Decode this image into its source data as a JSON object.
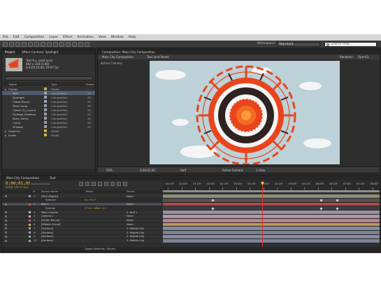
{
  "menu": [
    "File",
    "Edit",
    "Composition",
    "Layer",
    "Effect",
    "Animation",
    "View",
    "Window",
    "Help"
  ],
  "toolbar": {
    "workspace_label": "Workspace:",
    "workspace_value": "Standard",
    "search_placeholder": "Search Help"
  },
  "project": {
    "tabs": [
      "Project",
      "Effect Controls: Spotlight"
    ],
    "info": [
      "Text 6 ▾, used once",
      "862 x 318 (1.00)",
      "Δ 0;00;10;00, 29.97 fps"
    ],
    "columns": [
      "Name",
      "Type",
      "Frame"
    ],
    "rows": [
      {
        "name": "Comps",
        "type": "Folder",
        "frame": "",
        "color": "#c9b23a",
        "indent": 0
      },
      {
        "name": "Text",
        "type": "Composition",
        "frame": "29",
        "color": "#9aa0ad",
        "indent": 1
      },
      {
        "name": "Spotlight",
        "type": "Composition",
        "frame": "29",
        "color": "#9aa0ad",
        "indent": 1
      },
      {
        "name": "Chase Racuz",
        "type": "Composition",
        "frame": "29",
        "color": "#9aa0ad",
        "indent": 1
      },
      {
        "name": "Main Comp",
        "type": "Composition",
        "frame": "29",
        "color": "#9aa0ad",
        "indent": 1
      },
      {
        "name": "Chase (1)_Layout",
        "type": "Composition",
        "frame": "29",
        "color": "#9aa0ad",
        "indent": 1
      },
      {
        "name": "Footage_Skeleton",
        "type": "Composition",
        "frame": "29",
        "color": "#9aa0ad",
        "indent": 1
      },
      {
        "name": "Bone_Racks",
        "type": "Composition",
        "frame": "29",
        "color": "#9aa0ad",
        "indent": 1
      },
      {
        "name": "Comp",
        "type": "Composition",
        "frame": "29",
        "color": "#9aa0ad",
        "indent": 1
      },
      {
        "name": "Shadow",
        "type": "Composition",
        "frame": "29",
        "color": "#9aa0ad",
        "indent": 1
      },
      {
        "name": "Graphics",
        "type": "Folder",
        "frame": "",
        "color": "#c9b23a",
        "indent": 0
      },
      {
        "name": "Solids",
        "type": "Folder",
        "frame": "",
        "color": "#c9b23a",
        "indent": 0
      }
    ]
  },
  "comp": {
    "tab_title": "Composition: Main City Composition",
    "sub_tabs": [
      "Main City Composition",
      "Text (and Panel)"
    ],
    "active_camera": "Active Camera",
    "renderer_label": "Renderer:",
    "renderer_value": "OpenGL",
    "footer": {
      "zoom": "50%",
      "timecode": "0;00;01;00",
      "resolution": "Half",
      "view": "Active Camera",
      "views": "1 View"
    },
    "colors": {
      "sky": "#bcd1d8",
      "orange": "#e9451d",
      "sun": "#f36a24",
      "snow": "#f4f5f4"
    }
  },
  "timeline": {
    "tabs": [
      "Main City Composition",
      "Text"
    ],
    "timecode": "0;00;01;00",
    "frameinfo": "00030 (29.97 fps)",
    "columns": [
      "#",
      "Source Name",
      "Mode",
      "Parent"
    ],
    "layers": [
      {
        "num": "1",
        "name": "[Text (Right)]",
        "prop": "",
        "parent": "None",
        "color": "#9aa0ad",
        "type": "layer",
        "sel": false
      },
      {
        "num": "",
        "name": "Rotation",
        "prop": "0x +0.0°",
        "parent": "",
        "color": "",
        "type": "sub",
        "sel": false
      },
      {
        "num": "2",
        "name": "Null 1",
        "prop": "",
        "parent": "None",
        "color": "#e44",
        "type": "layer",
        "sel": true
      },
      {
        "num": "",
        "name": "Position",
        "prop": "274.0, 186.0, 0.0",
        "parent": "",
        "color": "",
        "type": "sub",
        "sel": false
      },
      {
        "num": "3",
        "name": "Main Camera",
        "prop": "",
        "parent": "2. Null 1",
        "color": "#c5b2c7",
        "type": "layer",
        "sel": false
      },
      {
        "num": "4",
        "name": "Camera 1",
        "prop": "",
        "parent": "None",
        "color": "#c5b2c7",
        "type": "layer",
        "sel": false
      },
      {
        "num": "5",
        "name": "[Green Racuz]",
        "prop": "",
        "parent": "None",
        "color": "#d45a5a",
        "type": "layer",
        "sel": false
      },
      {
        "num": "6",
        "name": "[Middle City.ai]",
        "prop": "",
        "parent": "None",
        "color": "#d9b33d",
        "type": "layer",
        "sel": false
      },
      {
        "num": "7",
        "name": "[Surface]",
        "prop": "",
        "parent": "2. Middle City",
        "color": "#9aa0ad",
        "type": "layer",
        "sel": false
      },
      {
        "num": "8",
        "name": "[Surface]",
        "prop": "",
        "parent": "2. Middle City",
        "color": "#9aa0ad",
        "type": "layer",
        "sel": false
      },
      {
        "num": "9",
        "name": "[Surface]",
        "prop": "",
        "parent": "2. Middle City",
        "color": "#9aa0ad",
        "type": "layer",
        "sel": false
      },
      {
        "num": "10",
        "name": "[Surface]",
        "prop": "",
        "parent": "2. Middle City",
        "color": "#9aa0ad",
        "type": "layer",
        "sel": false
      }
    ],
    "ruler_marks": [
      "00:15f",
      "01:00f",
      "01:15f",
      "02:00f",
      "02:15f",
      "03:00f",
      "03:15f",
      "04:00f",
      "04:15f",
      "05:00f",
      "05:15f",
      "06:00f",
      "06:15f",
      "07:00f",
      "07:15f",
      "08:00f"
    ],
    "track_colors": [
      "#8c8c78",
      "#525252",
      "#b7464b",
      "#3e3e3e",
      "#9d8ea3",
      "#a599ac",
      "#c27f86",
      "#b79a54",
      "#858aa0",
      "#7c8196",
      "#868b9f",
      "#7f8498"
    ],
    "footer_mode": "Toggle Switches / Modes"
  }
}
